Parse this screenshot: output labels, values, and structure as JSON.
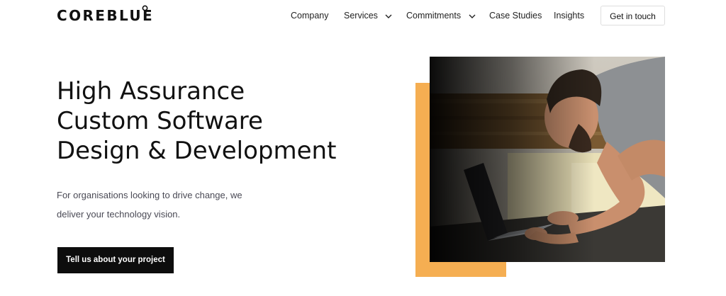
{
  "brand": {
    "name": "COREBLUE"
  },
  "nav": {
    "items": [
      {
        "label": "Company",
        "dropdown": false
      },
      {
        "label": "Services",
        "dropdown": true
      },
      {
        "label": "Commitments",
        "dropdown": true
      },
      {
        "label": "Case Studies",
        "dropdown": false
      },
      {
        "label": "Insights",
        "dropdown": false
      }
    ],
    "cta_label": "Get in touch"
  },
  "hero": {
    "title_lines": [
      "High Assurance",
      "Custom Software",
      "Design & Development"
    ],
    "subtitle_lines": [
      "For organisations looking to drive change, we",
      "deliver your technology vision."
    ],
    "button_label": "Tell us about your project"
  },
  "colors": {
    "accent": "#f5ae52",
    "button_dark": "#0d0d0d",
    "text": "#111111"
  },
  "icons": {
    "dropdown": "chevron-down-icon",
    "logo_mark": "circle-logo-icon"
  }
}
